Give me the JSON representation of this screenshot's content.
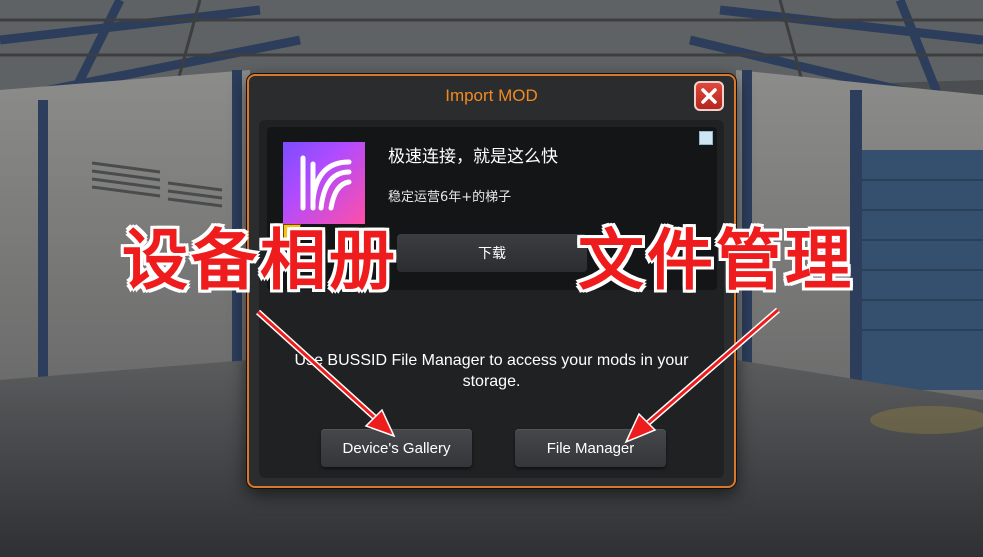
{
  "dialog": {
    "title": "Import MOD",
    "close_icon": "close-x-icon"
  },
  "ad": {
    "icon": "app-logo-icon",
    "title": "极速连接，就是这么快",
    "subtitle": "稳定运营6年+的梯子",
    "download_label": "下载",
    "adchoices_icon": "adchoices-icon"
  },
  "description": "Use BUSSID File Manager to access your mods in your storage.",
  "buttons": {
    "gallery_label": "Device's Gallery",
    "file_manager_label": "File Manager"
  },
  "annotations": {
    "left_caption": "设备相册",
    "right_caption": "文件管理",
    "color": "#ee1c1c"
  },
  "colors": {
    "accent": "#f08a24",
    "close": "#c8342a"
  }
}
